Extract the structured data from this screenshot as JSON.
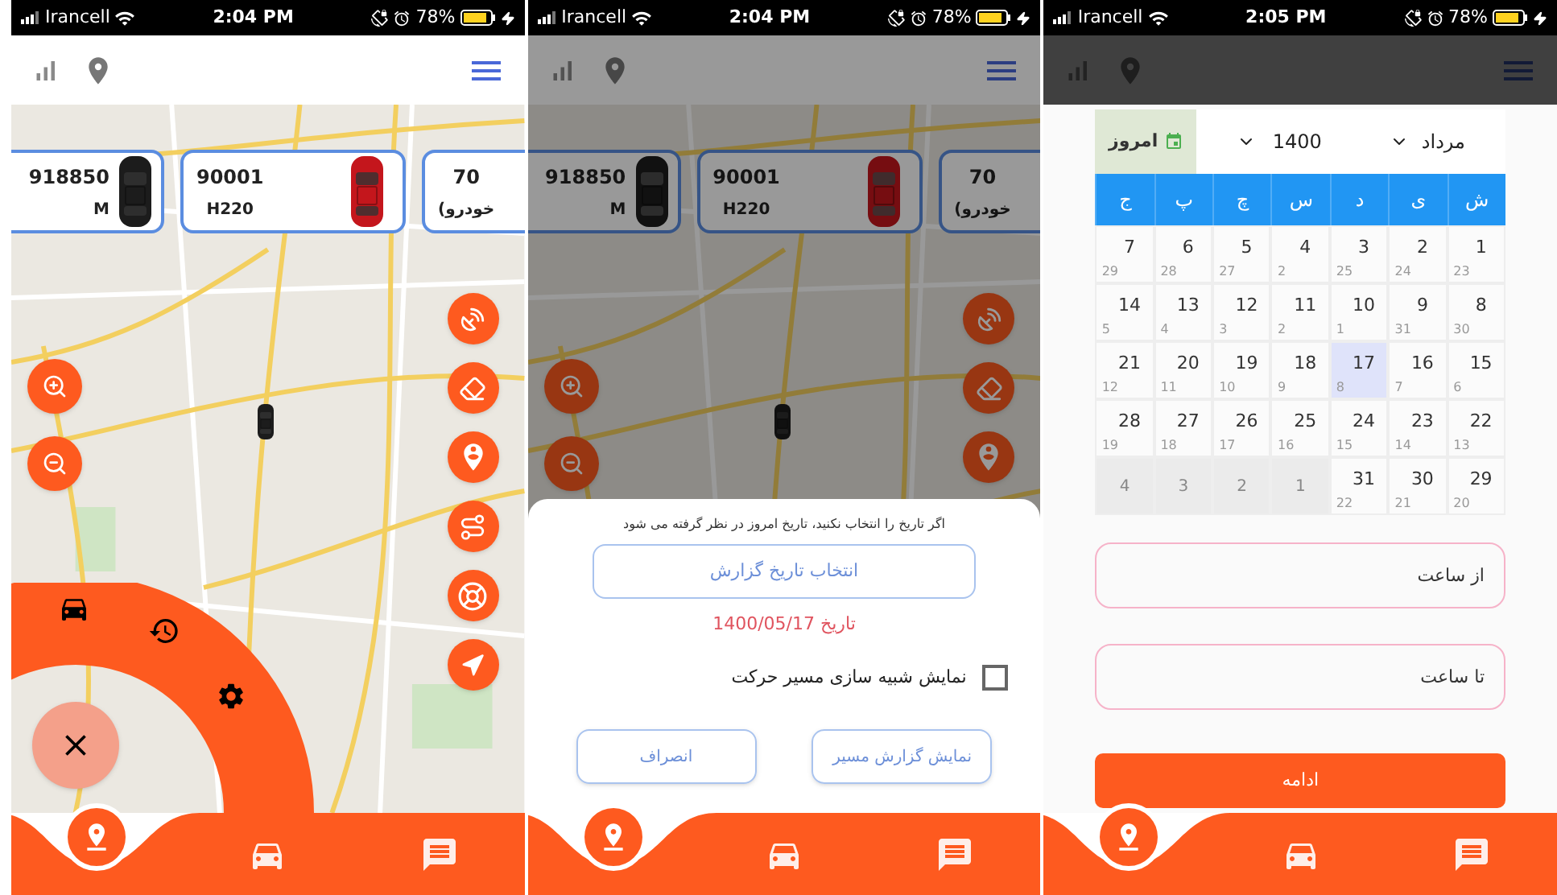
{
  "phones": [
    {
      "status_bar": {
        "carrier": "Irancell",
        "time": "2:05 PM",
        "battery": "78%"
      },
      "dimmed": true,
      "kind": "calendar",
      "calendar": {
        "today": "امروز",
        "year": "1400",
        "month": "مرداد",
        "weekdays": [
          "ش",
          "ی",
          "د",
          "س",
          "چ",
          "پ",
          "ج"
        ],
        "days": [
          {
            "day": "1",
            "alt": "23",
            "outside": false,
            "selected": false
          },
          {
            "day": "2",
            "alt": "24",
            "outside": false,
            "selected": false
          },
          {
            "day": "3",
            "alt": "25",
            "outside": false,
            "selected": false
          },
          {
            "day": "4",
            "alt": "2",
            "outside": false,
            "selected": false
          },
          {
            "day": "5",
            "alt": "27",
            "outside": false,
            "selected": false
          },
          {
            "day": "6",
            "alt": "28",
            "outside": false,
            "selected": false
          },
          {
            "day": "7",
            "alt": "29",
            "outside": false,
            "selected": false
          },
          {
            "day": "8",
            "alt": "30",
            "outside": false,
            "selected": false
          },
          {
            "day": "9",
            "alt": "31",
            "outside": false,
            "selected": false
          },
          {
            "day": "10",
            "alt": "1",
            "outside": false,
            "selected": false
          },
          {
            "day": "11",
            "alt": "2",
            "outside": false,
            "selected": false
          },
          {
            "day": "12",
            "alt": "3",
            "outside": false,
            "selected": false
          },
          {
            "day": "13",
            "alt": "4",
            "outside": false,
            "selected": false
          },
          {
            "day": "14",
            "alt": "5",
            "outside": false,
            "selected": false
          },
          {
            "day": "15",
            "alt": "6",
            "outside": false,
            "selected": false
          },
          {
            "day": "16",
            "alt": "7",
            "outside": false,
            "selected": false
          },
          {
            "day": "17",
            "alt": "8",
            "outside": false,
            "selected": true
          },
          {
            "day": "18",
            "alt": "9",
            "outside": false,
            "selected": false
          },
          {
            "day": "19",
            "alt": "10",
            "outside": false,
            "selected": false
          },
          {
            "day": "20",
            "alt": "11",
            "outside": false,
            "selected": false
          },
          {
            "day": "21",
            "alt": "12",
            "outside": false,
            "selected": false
          },
          {
            "day": "22",
            "alt": "13",
            "outside": false,
            "selected": false
          },
          {
            "day": "23",
            "alt": "14",
            "outside": false,
            "selected": false
          },
          {
            "day": "24",
            "alt": "15",
            "outside": false,
            "selected": false
          },
          {
            "day": "25",
            "alt": "16",
            "outside": false,
            "selected": false
          },
          {
            "day": "26",
            "alt": "17",
            "outside": false,
            "selected": false
          },
          {
            "day": "27",
            "alt": "18",
            "outside": false,
            "selected": false
          },
          {
            "day": "28",
            "alt": "19",
            "outside": false,
            "selected": false
          },
          {
            "day": "29",
            "alt": "20",
            "outside": false,
            "selected": false
          },
          {
            "day": "30",
            "alt": "21",
            "outside": false,
            "selected": false
          },
          {
            "day": "31",
            "alt": "22",
            "outside": false,
            "selected": false
          },
          {
            "day": "1",
            "outside": true,
            "selected": false
          },
          {
            "day": "2",
            "outside": true,
            "selected": false
          },
          {
            "day": "3",
            "outside": true,
            "selected": false
          },
          {
            "day": "4",
            "outside": true,
            "selected": false
          }
        ]
      },
      "fields": [
        {
          "placeholder": "از ساعت"
        },
        {
          "placeholder": "تا ساعت"
        }
      ],
      "submit": "ادامه",
      "nav": [
        {
          "kind": "message",
          "selected": false
        },
        {
          "kind": "car",
          "selected": false
        },
        {
          "kind": "pin",
          "selected": true
        }
      ]
    },
    {
      "status_bar": {
        "carrier": "Irancell",
        "time": "2:04 PM",
        "battery": "78%"
      },
      "dimmed": true,
      "kind": "map",
      "vehicles": [
        {
          "plate": "70",
          "model": "(خودرو"
        },
        {
          "plate": "90001",
          "model": "H220",
          "color": "#760d11"
        },
        {
          "plate": "918850",
          "model": "M",
          "color": "#111111"
        }
      ],
      "dialog": {
        "hint": "اگر تاریخ را انتخاب نکنید، تاریخ امروز در نظر گرفته می شود",
        "pick_button": "انتخاب تاریخ گزارش",
        "date": "تاریخ 1400/05/17",
        "checkbox": {
          "label": "نمایش شبیه سازی مسیر حرکت",
          "checked": false
        },
        "buttons": [
          "نمایش گزارش مسیر",
          "انصراف"
        ]
      },
      "nav": [
        {
          "kind": "message",
          "selected": false
        },
        {
          "kind": "car",
          "selected": false
        },
        {
          "kind": "pin",
          "selected": true
        }
      ]
    },
    {
      "status_bar": {
        "carrier": "Irancell",
        "time": "2:04 PM",
        "battery": "78%"
      },
      "dimmed": false,
      "kind": "map",
      "radial_menu_open": true,
      "vehicles": [
        {
          "plate": "70",
          "model": "(خودرو"
        },
        {
          "plate": "90001",
          "model": "H220",
          "color": "#c4161c"
        },
        {
          "plate": "918850",
          "model": "M",
          "color": "#1c1c1c"
        }
      ],
      "nav": [
        {
          "kind": "message",
          "selected": false
        },
        {
          "kind": "car",
          "selected": false
        },
        {
          "kind": "pin",
          "selected": true
        }
      ]
    }
  ]
}
